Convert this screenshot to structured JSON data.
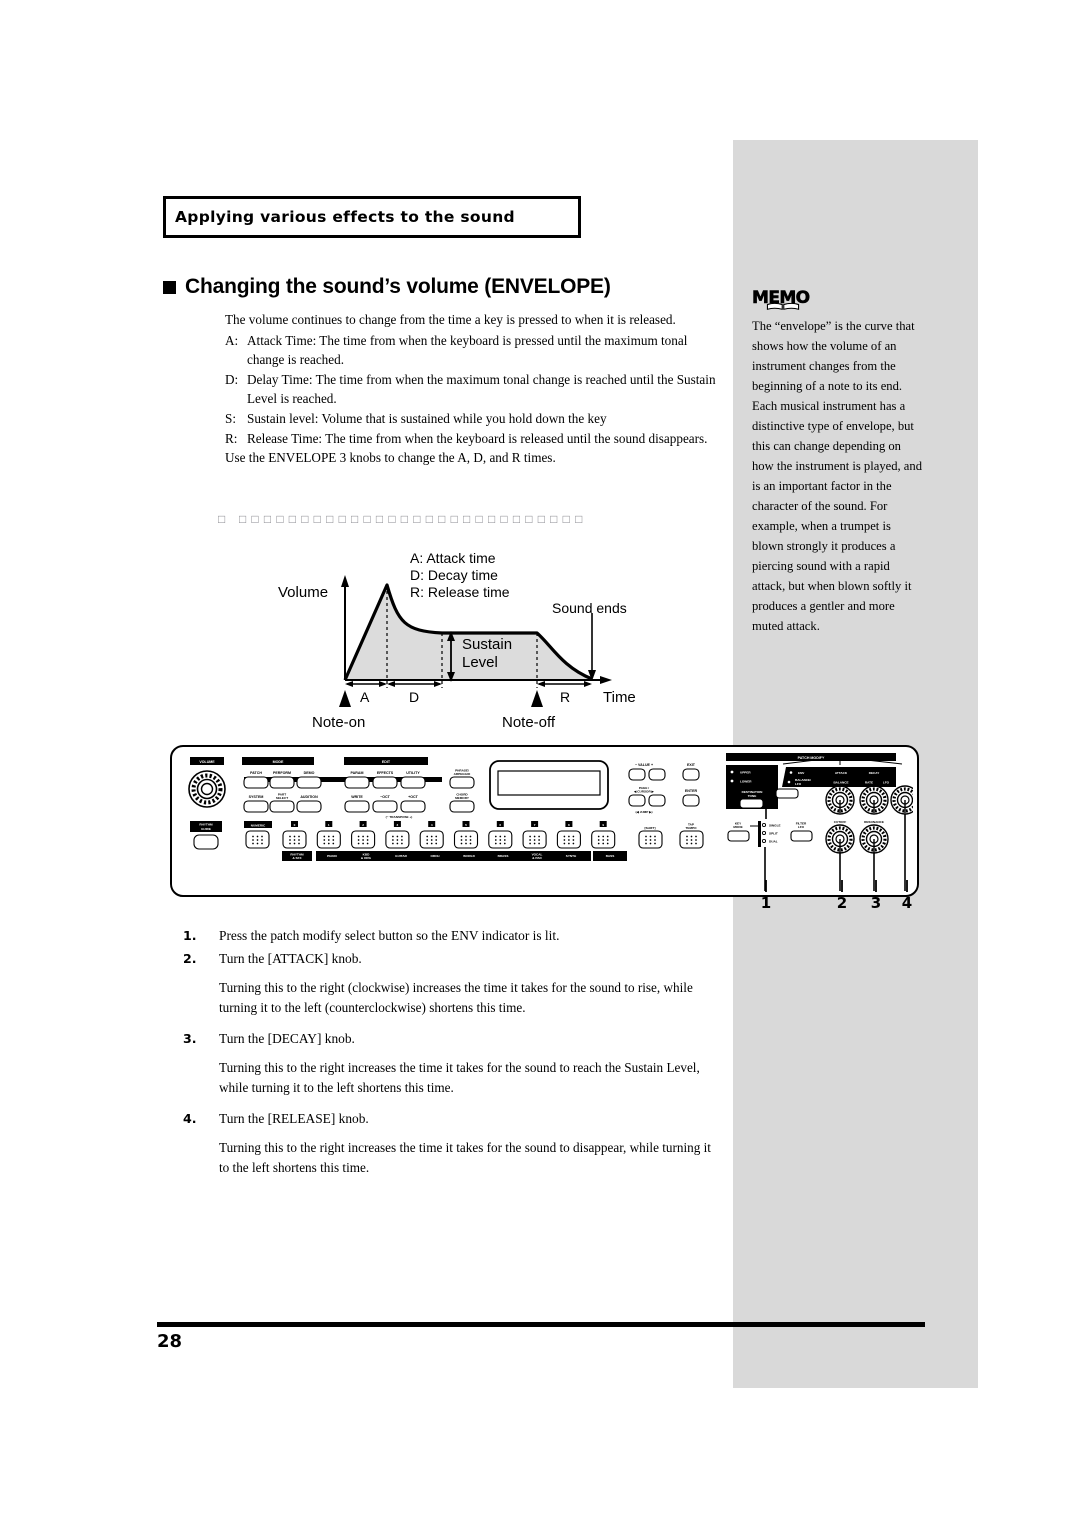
{
  "page": {
    "number": "28",
    "running_head": "Applying various effects to the sound",
    "section_heading": "Changing the sound’s volume (ENVELOPE)"
  },
  "body": {
    "intro": "The volume continues to change from the time a key is pressed to when it is released.",
    "definitions": [
      {
        "key": "A:",
        "text": "Attack Time: The time from when the keyboard is pressed until the maximum tonal change is reached."
      },
      {
        "key": "D:",
        "text": "Delay Time: The time from when the maximum tonal change is reached until the Sustain Level is reached."
      },
      {
        "key": "S:",
        "text": "Sustain level: Volume that is sustained while you hold down the key"
      },
      {
        "key": "R:",
        "text": "Release Time: The time from when the keyboard is released until the sound disappears."
      }
    ],
    "use_note": "Use the ENVELOPE 3 knobs to change the A, D, and R times.",
    "separator_glyphs": "□ □□□□□□□□□□□□□□□□□□□□□□□□□□□□"
  },
  "memo": {
    "label": "MEMO",
    "text": "The “envelope” is the curve that shows how the volume of an instrument changes from the beginning of a note to its end. Each musical instrument has a distinctive type of envelope, but this can change depending on how the instrument is played, and is an important factor in the character of the sound. For example, when a trumpet is blown strongly it produces a piercing sound with a rapid attack, but when blown softly it produces a gentler and more muted attack."
  },
  "envelope_figure": {
    "axis_y_label": "Volume",
    "axis_x_label": "Time",
    "legend": [
      "A: Attack time",
      "D: Decay time",
      "R: Release time"
    ],
    "sound_ends_label": "Sound ends",
    "sustain_label_line1": "Sustain",
    "sustain_label_line2": "Level",
    "segment_labels": [
      "A",
      "D",
      "R"
    ],
    "note_on": "Note-on",
    "note_off": "Note-off"
  },
  "panel": {
    "volume_label": "VOLUME",
    "rhythm_guide": [
      "RHYTHM",
      "GUIDE"
    ],
    "mode_header": "MODE",
    "mode_buttons_top": [
      "PATCH",
      "PERFORM",
      "DEMO"
    ],
    "mode_buttons_bottom": [
      "SYSTEM",
      "PART SELECT",
      "AUDITION"
    ],
    "edit_header": "EDIT",
    "edit_buttons_top": [
      "PARAM",
      "EFFECTS",
      "UTILITY"
    ],
    "edit_buttons_bottom": [
      "WRITE",
      "−OCT",
      "+OCT"
    ],
    "transpose_label": "(− TRANSPOSE +)",
    "phrase_arpeggio": [
      "PHRASE/",
      "ARPEGGIO"
    ],
    "chord_memory": [
      "CHORD",
      "MEMORY"
    ],
    "value_label": "−  VALUE  +",
    "exit_label": "EXIT",
    "page_cursor": [
      "PAGE /",
      "◀ CURSOR ▶"
    ],
    "jump_label": "(◀ JUMP ▶)",
    "enter_label": "ENTER",
    "numeric_label": "NUMERIC",
    "shift_label": "[SHIFT]",
    "tap_tempo": [
      "TAP",
      "TEMPO"
    ],
    "tone_numbers": [
      "0",
      "1",
      "2",
      "3",
      "4",
      "5",
      "6",
      "7",
      "8",
      "9"
    ],
    "tone_names": [
      "RHYTHM & SFX",
      "PIANO",
      "KBD & ORG",
      "GUITAR",
      "ORCH",
      "WORLD",
      "BRASS",
      "VOCAL & PAD",
      "SYNTH",
      "BASS"
    ],
    "patch_modify_header": "PATCH MODIFY",
    "destination_tone": [
      "DESTINATION",
      "TONE"
    ],
    "upper_label": "UPPER",
    "lower_label": "LOWER",
    "row_env": "ENV",
    "row_balance_lfo": "BALANCE/ LFO",
    "knob_top_labels": [
      "ATTACK",
      "DECAY",
      "RELEASE"
    ],
    "knob_alt_labels": [
      "BALANCE",
      "RATE",
      "LFO",
      "DEPTH"
    ],
    "knob_bottom_labels": [
      "CUTOFF",
      "RESONANCE"
    ],
    "key_mode_label": "KEY MODE",
    "key_mode_options": [
      "SINGLE",
      "SPLIT",
      "DUAL"
    ],
    "filter_lfo": [
      "FILTER",
      "LFO"
    ],
    "callouts": [
      "1",
      "2",
      "3",
      "4"
    ]
  },
  "steps": [
    {
      "num": "1.",
      "text": "Press the patch modify select button so the ENV indicator is lit."
    },
    {
      "num": "2.",
      "text": "Turn the [ATTACK] knob."
    },
    {
      "num": "3.",
      "text": "Turn the [DECAY] knob."
    },
    {
      "num": "4.",
      "text": "Turn the [RELEASE] knob."
    }
  ],
  "step_paragraphs": {
    "after_2": "Turning this to the right (clockwise) increases the time it takes for the sound to rise, while turning it to the left (counterclockwise) shortens this time.",
    "after_3": "Turning this to the right increases the time it takes for the sound to reach the Sustain Level, while turning it to the left shortens this time.",
    "after_4": "Turning this to the right increases the time it takes for the sound to disappear, while turning it to the left shortens this time."
  }
}
